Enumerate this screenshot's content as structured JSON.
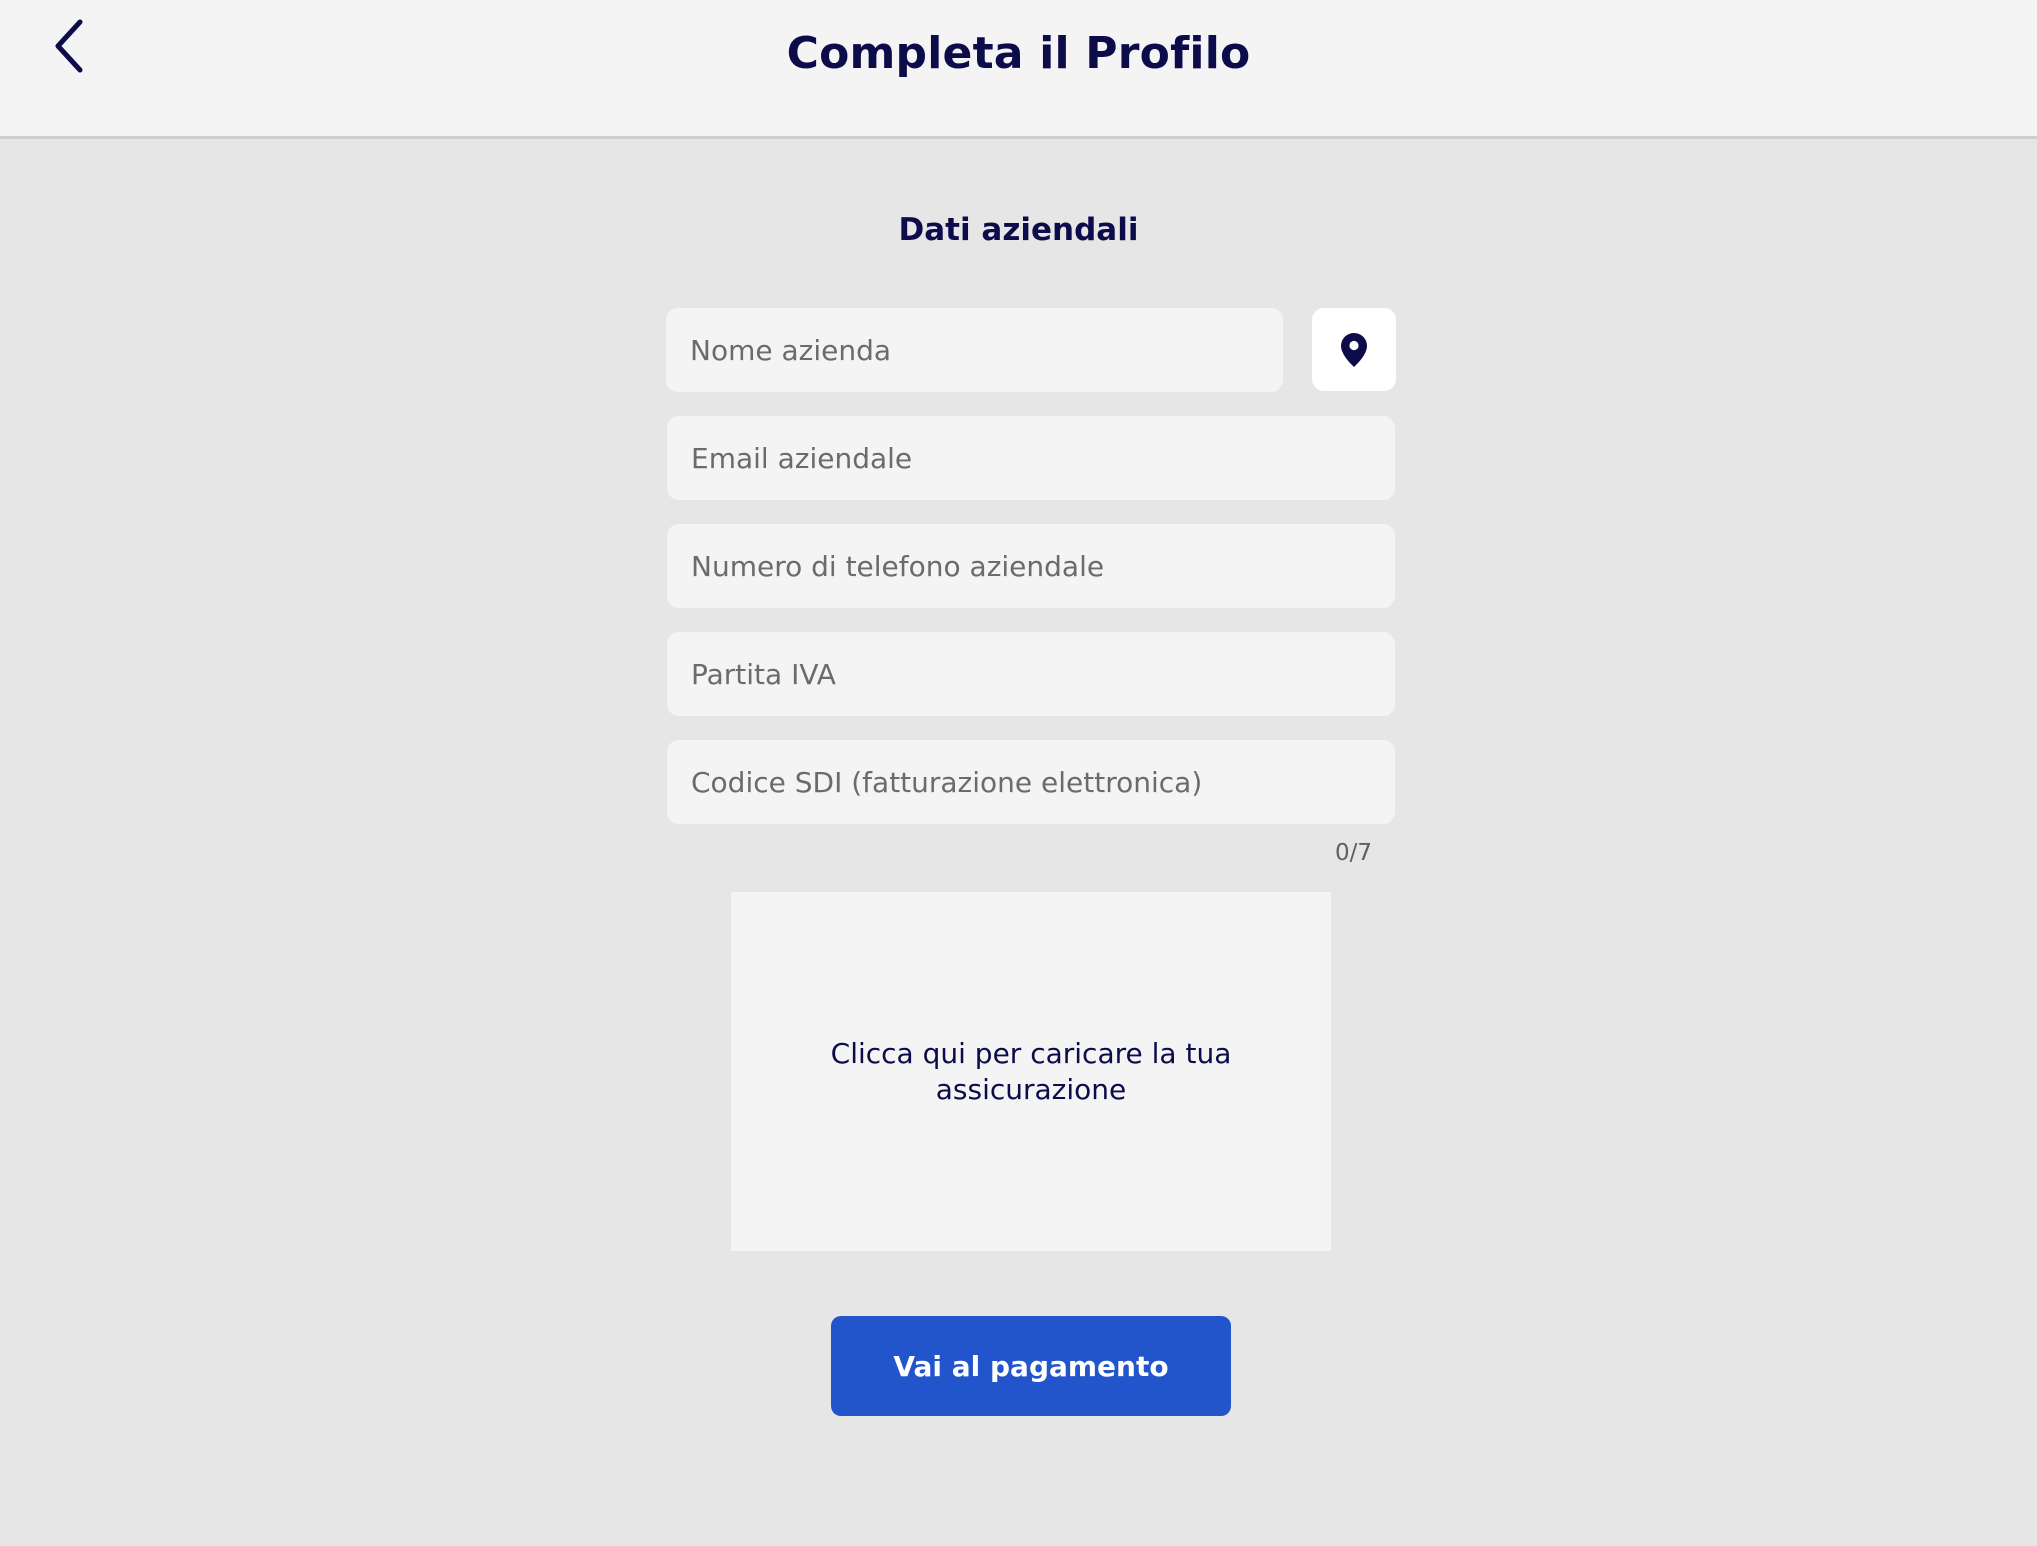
{
  "header": {
    "title": "Completa il Profilo",
    "back_icon": "chevron-left-icon"
  },
  "form": {
    "section_title": "Dati aziendali",
    "fields": [
      {
        "placeholder": "Nome azienda",
        "value": ""
      },
      {
        "placeholder": "Email aziendale",
        "value": ""
      },
      {
        "placeholder": "Numero di telefono aziendale",
        "value": ""
      },
      {
        "placeholder": "Partita IVA",
        "value": ""
      },
      {
        "placeholder": "Codice SDI (fatturazione elettronica)",
        "value": ""
      }
    ],
    "location_icon": "map-pin-icon",
    "sdi_counter": "0/7",
    "upload_label": "Clicca qui per caricare la tua assicurazione",
    "submit_label": "Vai al pagamento"
  },
  "colors": {
    "primary_text": "#0d0c4b",
    "accent": "#2255cc",
    "background": "#e6e6e6",
    "field_background": "#f4f4f4"
  }
}
